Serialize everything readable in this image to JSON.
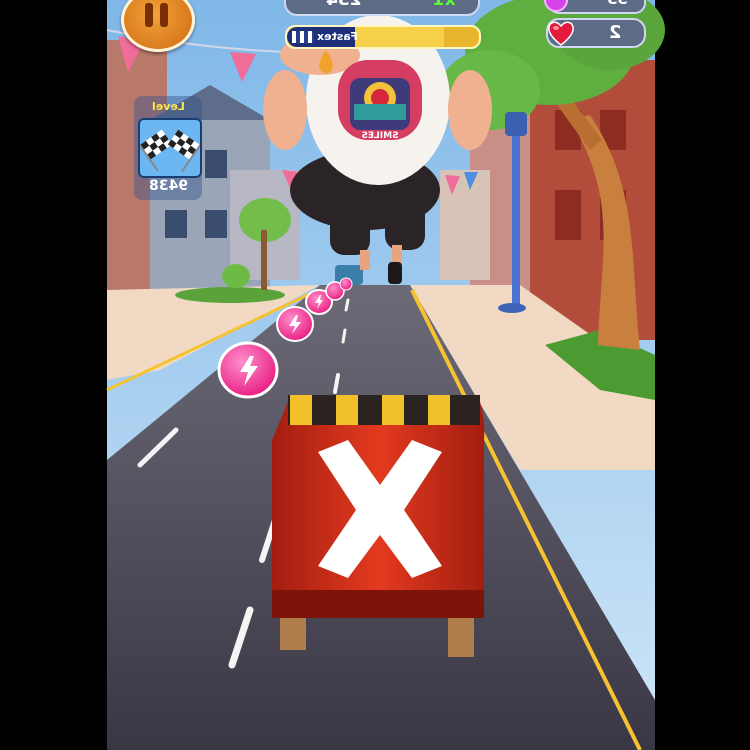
{
  "hud": {
    "score": "234",
    "multiplier": "x1",
    "gems": "53",
    "lives": "2",
    "level_label": "Level",
    "level_value": "9438",
    "boss_name": "Fastex",
    "boss_progress": 0.82
  },
  "shirt": {
    "print_text": "SMILES"
  },
  "icons": {
    "pause": "pause-icon",
    "gem": "gem-icon",
    "heart": "heart-icon",
    "level": "checkered-flags-icon",
    "boss_flag": "flag-icon",
    "pickup": "lightning-icon"
  },
  "colors": {
    "hud_panel": "#5d6b86",
    "multiplier": "#55ff32",
    "level_label": "#ffe44d",
    "pickup": "#ff3aa4",
    "barrier": "#d8321b"
  }
}
